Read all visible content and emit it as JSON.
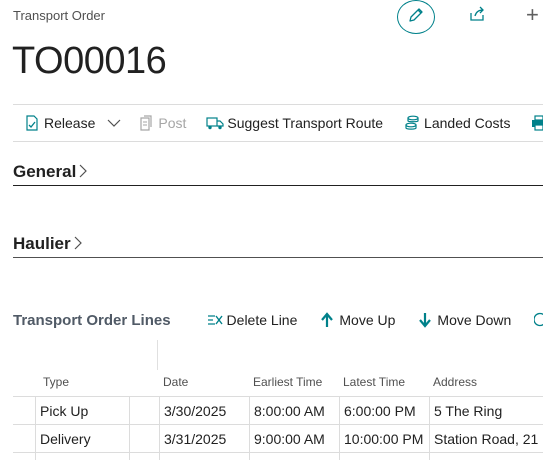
{
  "header": {
    "caption": "Transport Order",
    "record_no": "TO00016"
  },
  "actions": {
    "release": "Release",
    "post": "Post",
    "suggest_route": "Suggest Transport Route",
    "landed_costs": "Landed Costs",
    "print": "P"
  },
  "sections": {
    "general": "General",
    "haulier": "Haulier"
  },
  "lines": {
    "title": "Transport Order Lines",
    "delete_line": "Delete Line",
    "move_up": "Move Up",
    "move_down": "Move Down",
    "columns": {
      "type": "Type",
      "date": "Date",
      "earliest_time": "Earliest Time",
      "latest_time": "Latest Time",
      "address": "Address"
    },
    "rows": [
      {
        "type": "Pick Up",
        "date": "3/30/2025",
        "earliest_time": "8:00:00 AM",
        "latest_time": "6:00:00 PM",
        "address": "5 The Ring"
      },
      {
        "type": "Delivery",
        "date": "3/31/2025",
        "earliest_time": "9:00:00 AM",
        "latest_time": "10:00:00 PM",
        "address": "Station Road, 21"
      }
    ]
  },
  "colors": {
    "accent": "#00818a",
    "text": "#212121",
    "muted": "#505050",
    "disabled": "#a6a6a6"
  }
}
